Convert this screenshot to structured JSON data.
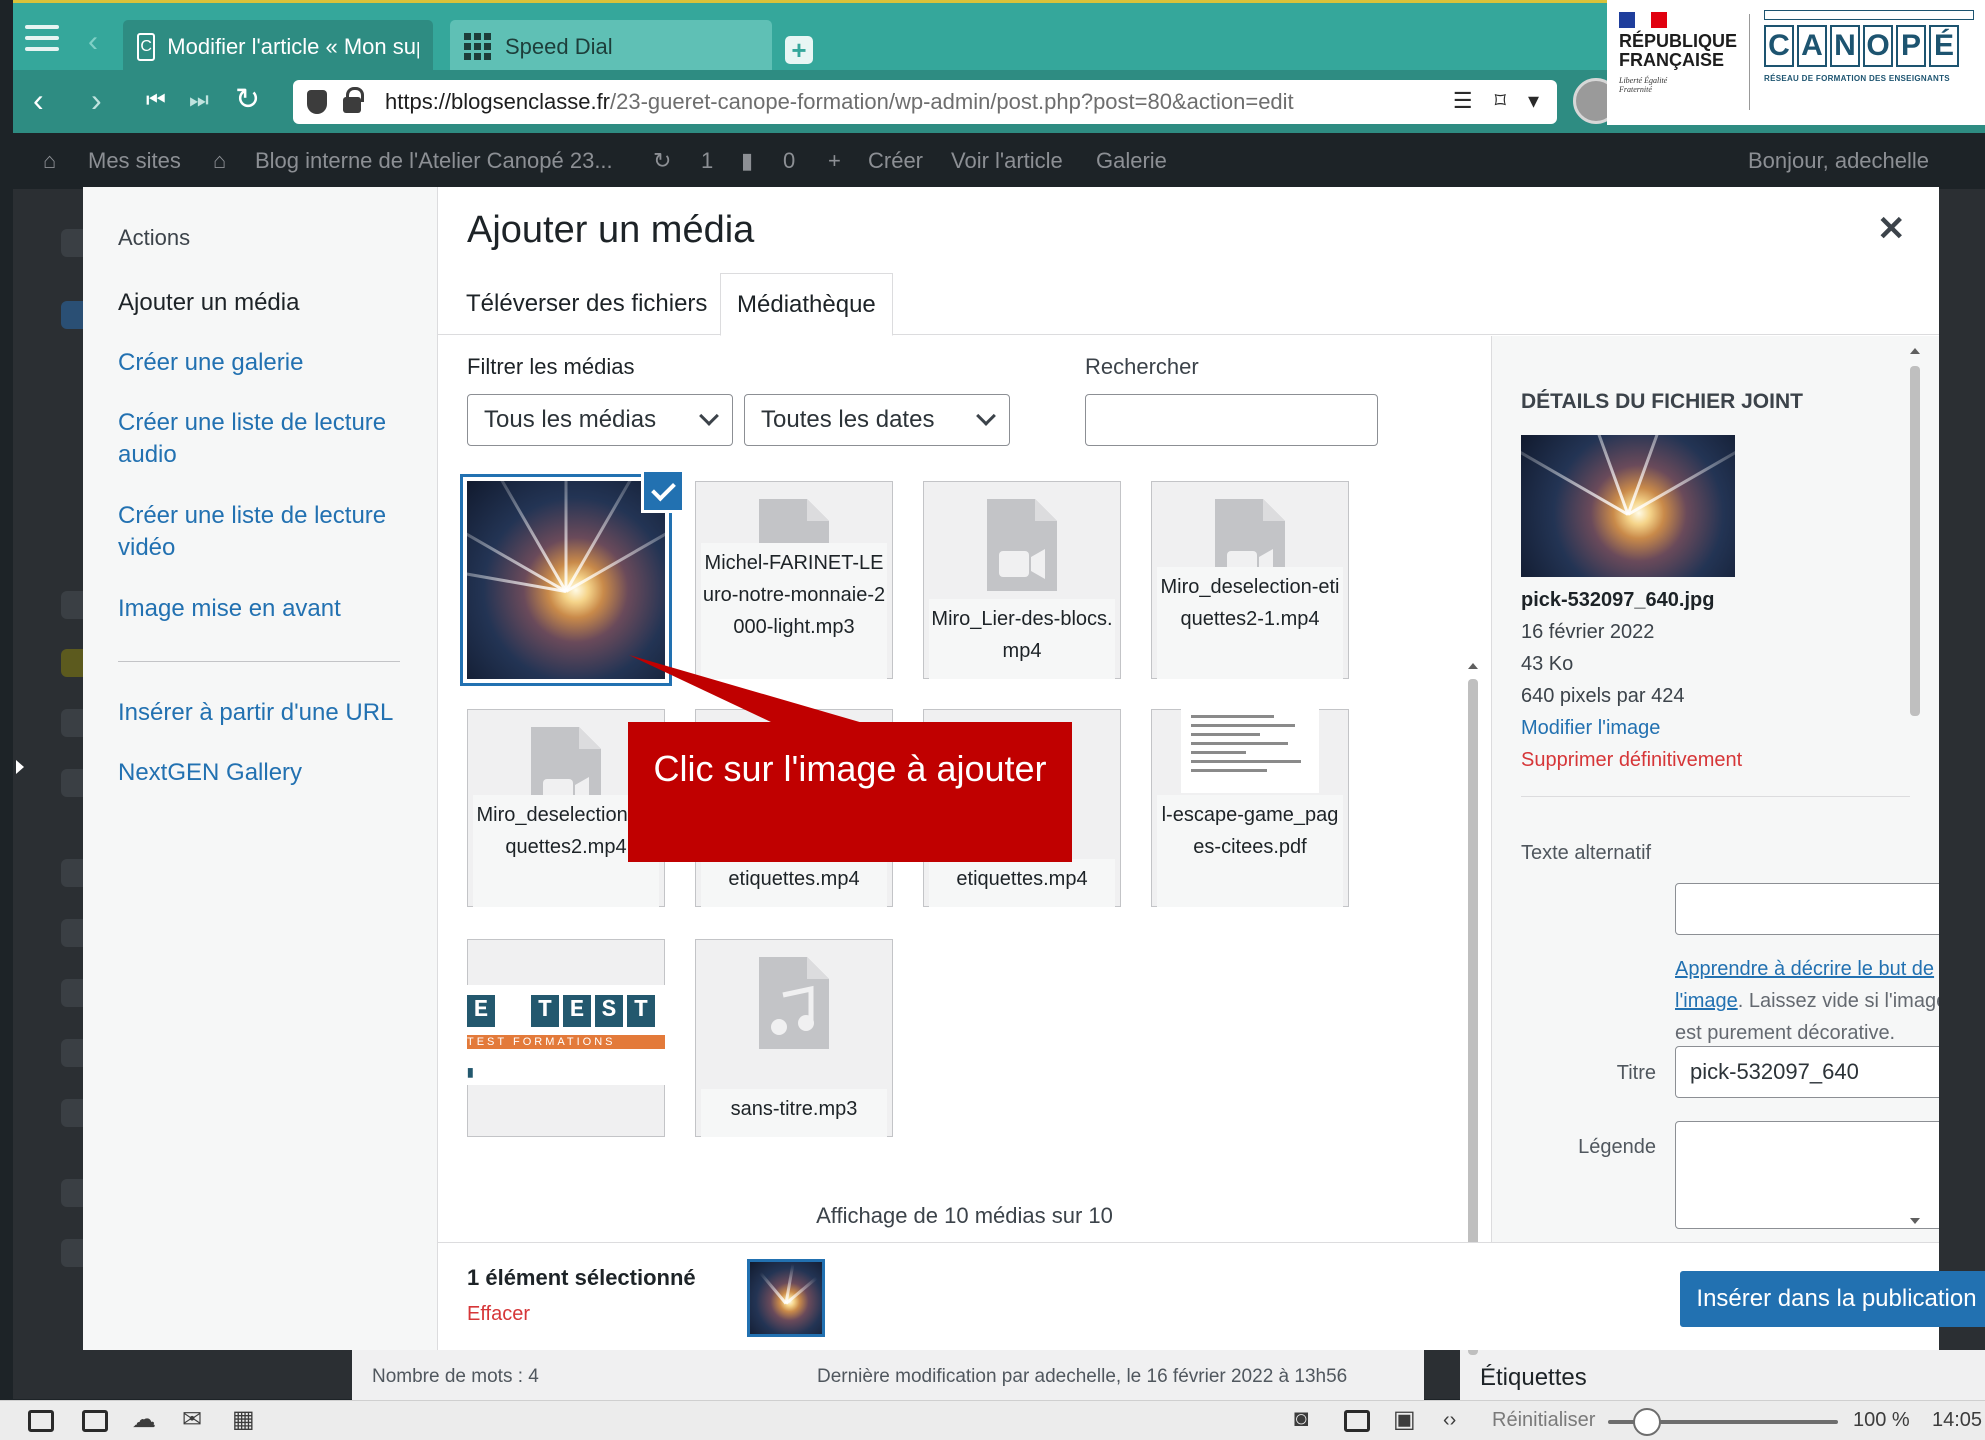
{
  "browser": {
    "tabs": [
      {
        "label": "Modifier l'article « Mon super article — Blog",
        "icon": "C"
      },
      {
        "label": "Speed Dial"
      }
    ],
    "url_host": "https://blogsenclasse.fr",
    "url_path": "/23-gueret-canope-formation/wp-admin/post.php?post=80&action=edit"
  },
  "branding": {
    "republique": "RÉPUBLIQUE FRANÇAISE",
    "motto": "Liberté Égalité Fraternité",
    "canope_letters": [
      "C",
      "A",
      "N",
      "O",
      "P",
      "É"
    ],
    "canope_sub": "RÉSEAU DE FORMATION DES ENSEIGNANTS"
  },
  "adminbar": {
    "my_sites": "Mes sites",
    "site_name": "Blog interne de l'Atelier Canopé 23...",
    "updates": "1",
    "comments": "0",
    "create": "Créer",
    "view_post": "Voir l'article",
    "gallery": "Galerie",
    "greeting": "Bonjour, adechelle"
  },
  "menu": {
    "heading": "Actions",
    "items": [
      "Ajouter un média",
      "Créer une galerie",
      "Créer une liste de lecture audio",
      "Créer une liste de lecture vidéo",
      "Image mise en avant"
    ],
    "items2": [
      "Insérer à partir d'une URL",
      "NextGEN Gallery"
    ]
  },
  "modal": {
    "title": "Ajouter un média",
    "tabs": [
      "Téléverser des fichiers",
      "Médiathèque"
    ],
    "filter_label": "Filtrer les médias",
    "filter_type": "Tous les médias",
    "filter_date": "Toutes les dates",
    "search_label": "Rechercher",
    "count_text": "Affichage de 10 médias sur 10"
  },
  "attachments": [
    {
      "name": "pick-532097_640.jpg",
      "kind": "image",
      "selected": true
    },
    {
      "name": "Michel-FARINET-LEuro-notre-monnaie-2000-light.mp3",
      "kind": "audio"
    },
    {
      "name": "Miro_Lier-des-blocs.mp4",
      "kind": "video"
    },
    {
      "name": "Miro_deselection-etiquettes2-1.mp4",
      "kind": "video"
    },
    {
      "name": "Miro_deselection-etiquettes2.mp4",
      "kind": "video"
    },
    {
      "name": "etiquettes.mp4",
      "kind": "video"
    },
    {
      "name": "etiquettes.mp4",
      "kind": "video"
    },
    {
      "name": "l-escape-game_pages-citees.pdf",
      "kind": "pdf"
    },
    {
      "name": "TEST FORMATIONS",
      "kind": "logo"
    },
    {
      "name": "sans-titre.mp3",
      "kind": "audio"
    }
  ],
  "callout": "Clic sur l'image à ajouter",
  "details": {
    "title": "Détails du fichier joint",
    "filename": "pick-532097_640.jpg",
    "date": "16 février 2022",
    "size": "43 Ko",
    "dimensions": "640 pixels par 424",
    "edit": "Modifier l'image",
    "delete": "Supprimer définitivement",
    "alt_label": "Texte alternatif",
    "alt_value": "",
    "help_link": "Apprendre à décrire le but de l'image",
    "help_text": ". Laissez vide si l'image est purement décorative.",
    "title_label": "Titre",
    "title_value": "pick-532097_640",
    "caption_label": "Légende"
  },
  "toolbar": {
    "selected": "1 élément sélectionné",
    "clear": "Effacer",
    "insert": "Insérer dans la publication"
  },
  "page_under": {
    "word_count": "Nombre de mots : 4",
    "last_modified": "Dernière modification par adechelle, le 16 février 2022 à 13h56",
    "tags_box": "Étiquettes"
  },
  "statusbar": {
    "reset": "Réinitialiser",
    "zoom": "100 %",
    "zoom_value": 0.17,
    "clock": "14:05"
  },
  "colors": {
    "accent": "#2271b1",
    "danger": "#d63638",
    "callout": "#c00000",
    "tabbar": "#35a79b"
  }
}
